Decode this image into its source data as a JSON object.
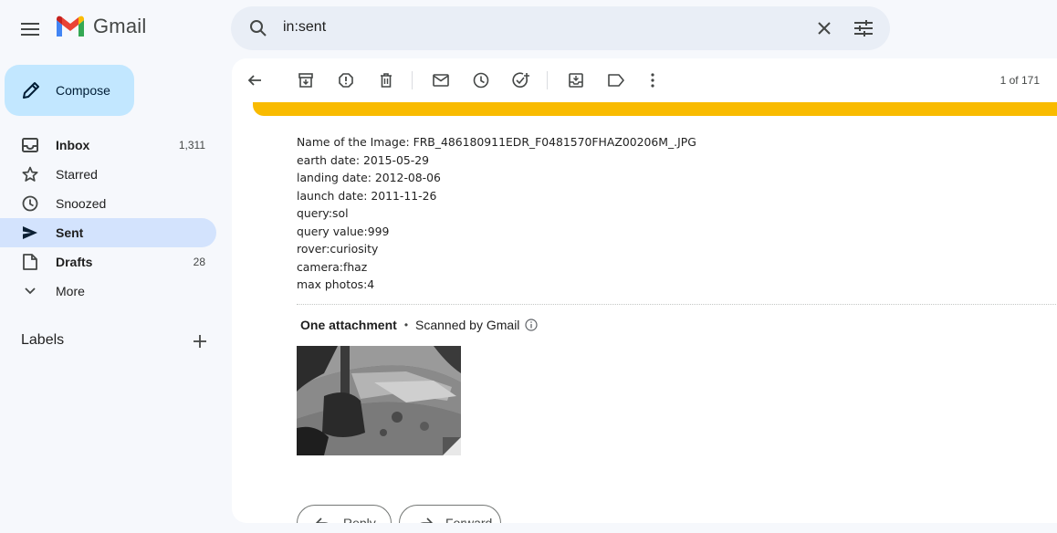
{
  "app": {
    "name": "Gmail"
  },
  "search": {
    "value": "in:sent"
  },
  "compose": {
    "label": "Compose"
  },
  "nav": [
    {
      "label": "Inbox",
      "count": "1,311",
      "icon": "inbox-icon",
      "bold": true
    },
    {
      "label": "Starred",
      "count": "",
      "icon": "star-icon"
    },
    {
      "label": "Snoozed",
      "count": "",
      "icon": "clock-icon"
    },
    {
      "label": "Sent",
      "count": "",
      "icon": "send-icon",
      "active": true,
      "bold": true
    },
    {
      "label": "Drafts",
      "count": "28",
      "icon": "draft-icon",
      "bold": true
    },
    {
      "label": "More",
      "count": "",
      "icon": "chevron-down-icon"
    }
  ],
  "labels": {
    "title": "Labels"
  },
  "toolbar": {
    "pager": "1 of 171"
  },
  "colors": {
    "accent": "#c2e7ff",
    "active_nav": "#d3e3fd",
    "banner": "#f9bb00",
    "bg": "#f6f8fc"
  },
  "message": {
    "lines": [
      "Name of the Image: FRB_486180911EDR_F0481570FHAZ00206M_.JPG",
      "earth date: 2015-05-29",
      "landing date: 2012-08-06",
      "launch date: 2011-11-26",
      "query:sol",
      "query value:999",
      "rover:curiosity",
      "camera:fhaz",
      "max photos:4"
    ]
  },
  "attachment": {
    "count_label": "One attachment",
    "separator": "•",
    "scan_label": "Scanned by Gmail"
  },
  "actions": {
    "reply": "Reply",
    "forward": "Forward"
  }
}
